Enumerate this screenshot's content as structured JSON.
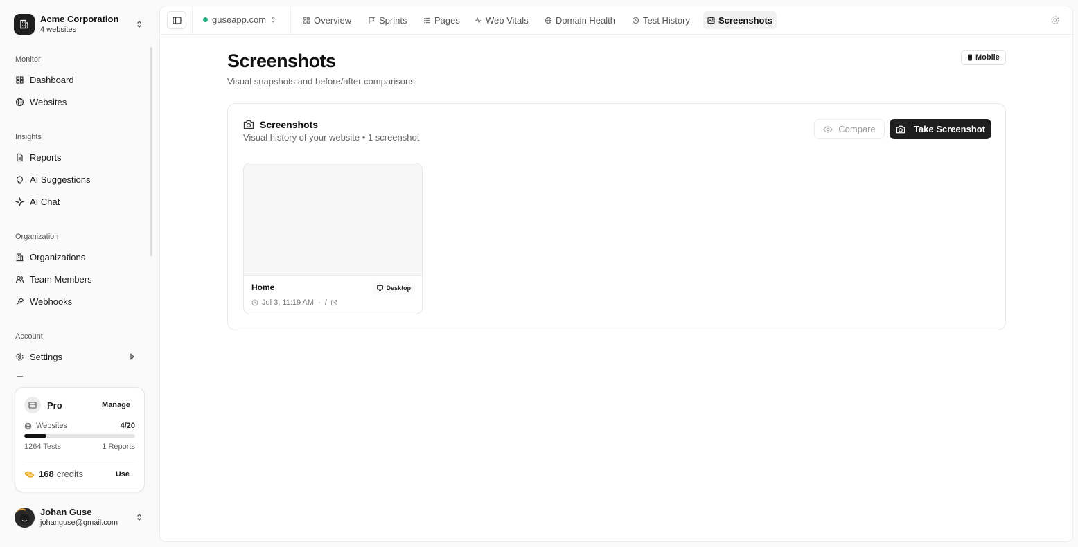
{
  "org": {
    "name": "Acme Corporation",
    "subtitle": "4 websites"
  },
  "nav": {
    "monitor_label": "Monitor",
    "dashboard": "Dashboard",
    "websites": "Websites",
    "insights_label": "Insights",
    "reports": "Reports",
    "ai_suggestions": "AI Suggestions",
    "ai_chat": "AI Chat",
    "organization_label": "Organization",
    "organizations": "Organizations",
    "team_members": "Team Members",
    "webhooks": "Webhooks",
    "account_label": "Account",
    "settings": "Settings"
  },
  "plan": {
    "name": "Pro",
    "manage_label": "Manage",
    "websites_label": "Websites",
    "websites_usage": "4/20",
    "websites_used_fraction": 0.2,
    "tests": "1264 Tests",
    "reports": "1 Reports",
    "credits_value": "168",
    "credits_label": "credits",
    "use_label": "Use"
  },
  "user": {
    "name": "Johan Guse",
    "email": "johanguse@gmail.com"
  },
  "topbar": {
    "site": "guseapp.com",
    "tabs": {
      "overview": "Overview",
      "sprints": "Sprints",
      "pages": "Pages",
      "web_vitals": "Web Vitals",
      "domain_health": "Domain Health",
      "test_history": "Test History",
      "screenshots": "Screenshots"
    }
  },
  "page": {
    "title": "Screenshots",
    "subtitle": "Visual snapshots and before/after comparisons",
    "device_toggle": "Mobile"
  },
  "card": {
    "title": "Screenshots",
    "subtitle": "Visual history of your website • 1 screenshot",
    "compare_label": "Compare",
    "take_label": "Take Screenshot",
    "screenshot": {
      "name": "Home",
      "device": "Desktop",
      "timestamp": "Jul 3, 11:19 AM",
      "path": "/"
    }
  },
  "colors": {
    "accent": "#1f1f1f",
    "status_online": "#22b07d",
    "coin": "#e8a317"
  }
}
